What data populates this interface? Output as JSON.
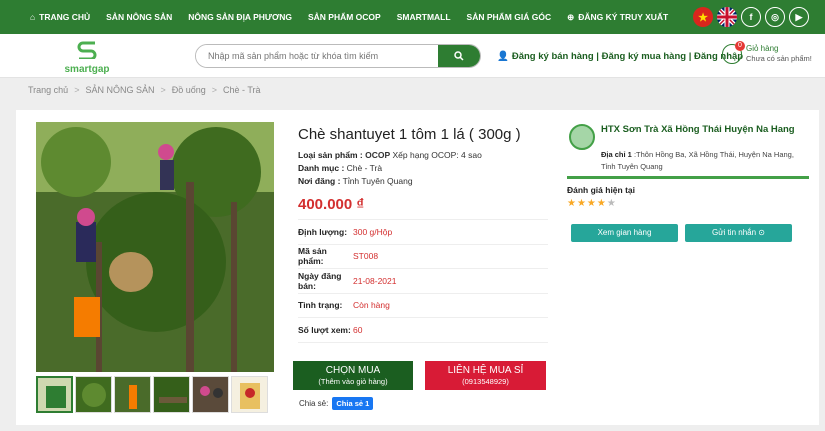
{
  "nav": {
    "items": [
      "TRANG CHỦ",
      "SẢN NÔNG SẢN",
      "NÔNG SẢN ĐỊA PHƯƠNG",
      "SẢN PHẨM OCOP",
      "SMARTMALL",
      "SẢN PHẨM GIÁ GÓC",
      "ĐĂNG KÝ TRUY XUẤT"
    ],
    "icons": [
      "vietnam-flag",
      "uk-flag",
      "facebook-icon",
      "instagram-icon",
      "youtube-icon"
    ]
  },
  "header": {
    "logo_text": "smartgap",
    "search_placeholder": "Nhập mã sản phẩm hoặc từ khóa tìm kiếm",
    "account_links": "Đăng ký bán hàng | Đăng ký mua hàng | Đăng nhập",
    "cart_count": "0",
    "cart_title": "Giỏ hàng",
    "cart_status": "Chưa có sản phẩm!"
  },
  "breadcrumb": [
    "Trang chủ",
    "SẢN NÔNG SẢN",
    "Đồ uống",
    "Chè - Trà"
  ],
  "product": {
    "title": "Chè shantuyet 1 tôm 1 lá ( 300g )",
    "type_label": "Loại sản phẩm :",
    "ocop_logo": "OCOP",
    "ocop_rank": "Xếp hạng OCOP: 4 sao",
    "category_label": "Danh mục :",
    "category": "Chè - Trà",
    "origin_label": "Nơi đăng :",
    "origin": "Tỉnh Tuyên Quang",
    "price": "400.000 ₫",
    "details": [
      {
        "label": "Định lượng:",
        "value": "300 g/Hộp"
      },
      {
        "label": "Mã sản phẩm:",
        "value": "ST008"
      },
      {
        "label": "Ngày đăng bán:",
        "value": "21-08-2021"
      },
      {
        "label": "Tình trạng:",
        "value": "Còn hàng"
      },
      {
        "label": "Số lượt xem:",
        "value": "60"
      }
    ],
    "buy_label": "CHỌN MUA",
    "buy_sub": "(Thêm vào giỏ hàng)",
    "contact_label": "LIÊN HỆ MUA SỈ",
    "contact_sub": "(0913548929)",
    "share_label": "Chia sẻ:",
    "fb_share": "Chia sẻ 1"
  },
  "seller": {
    "name": "HTX Sơn Trà Xã Hồng Thái Huyện Na Hang",
    "address_label": "Địa chỉ 1",
    "address": ":Thôn Hồng Ba, Xã Hồng Thái, Huyện Na Hang, Tỉnh Tuyên Quang",
    "rating_label": "Đánh giá hiện tại",
    "rating_stars": 4,
    "rating_max": 5,
    "view_store": "Xem gian hàng",
    "send_message": "Gửi tin nhắn ⊙"
  },
  "colors": {
    "nav_green": "#2e7d32",
    "price_red": "#d32f2f",
    "buy_green": "#1b5e20",
    "contact_red": "#d81b36",
    "teal": "#26a69a"
  }
}
